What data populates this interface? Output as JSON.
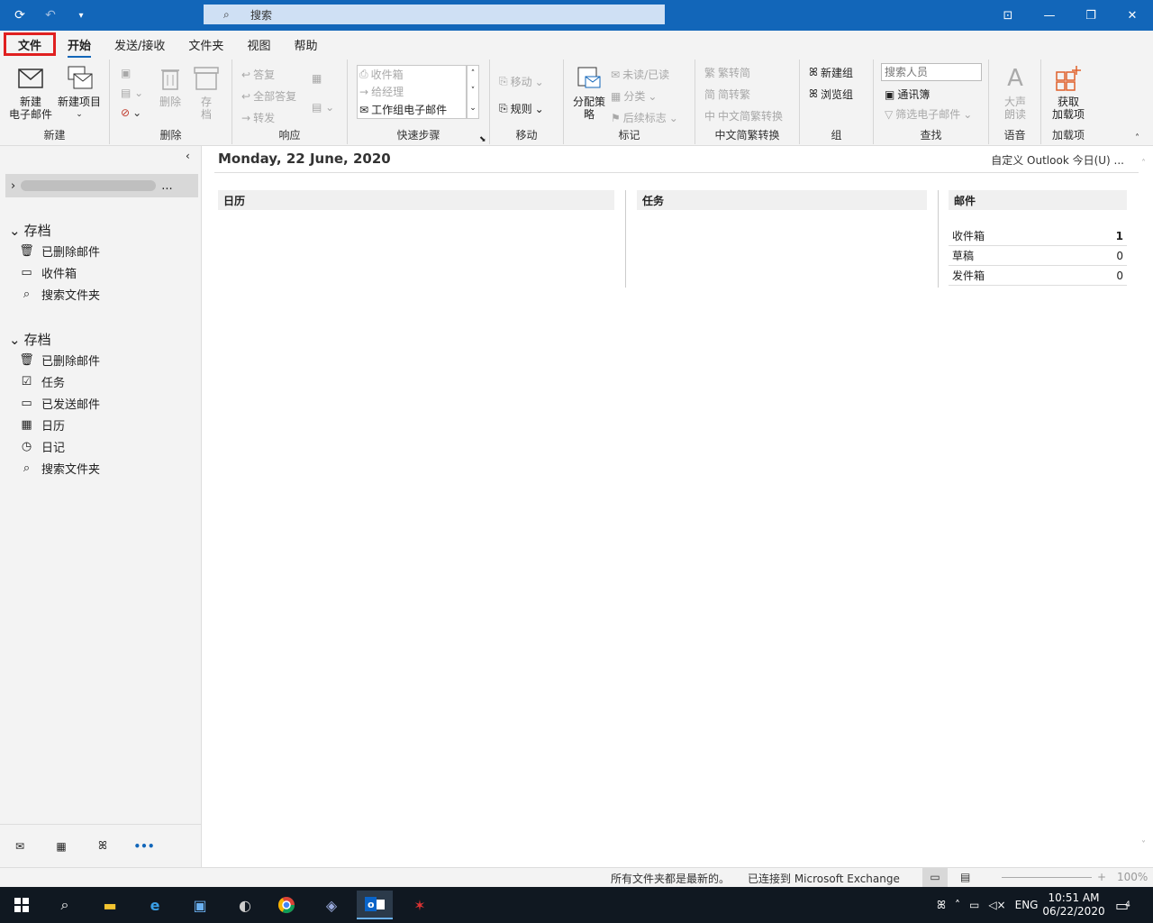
{
  "titlebar": {
    "search_label": "搜索"
  },
  "tabs": {
    "file": "文件",
    "home": "开始",
    "send_receive": "发送/接收",
    "folder": "文件夹",
    "view": "视图",
    "help": "帮助"
  },
  "ribbon": {
    "new": {
      "new_email": "新建\n电子邮件",
      "new_email_l1": "新建",
      "new_email_l2": "电子邮件",
      "new_item": "新建项目",
      "group": "新建"
    },
    "delete": {
      "delete": "删除",
      "archive_l1": "存",
      "archive_l2": "档",
      "group": "删除"
    },
    "respond": {
      "reply": "答复",
      "reply_all": "全部答复",
      "forward": "转发",
      "group": "响应"
    },
    "quicksteps": {
      "items": [
        "收件箱",
        "给经理",
        "工作组电子邮件"
      ],
      "group": "快速步骤"
    },
    "move": {
      "move": "移动",
      "rules": "规则",
      "group": "移动"
    },
    "tags": {
      "assign_policy_l1": "分配策",
      "assign_policy_l2": "略",
      "unread_read": "未读/已读",
      "categorize": "分类",
      "follow_up": "后续标志",
      "group": "标记"
    },
    "chinese": {
      "trad_to_simp": "繁转简",
      "simp_to_trad": "简转繁",
      "convert": "中文简繁转换",
      "group": "中文简繁转换"
    },
    "groups": {
      "new_group": "新建组",
      "browse_groups": "浏览组",
      "group": "组"
    },
    "find": {
      "search_people_placeholder": "搜索人员",
      "address_book": "通讯簿",
      "filter_email": "筛选电子邮件",
      "group": "查找"
    },
    "speech": {
      "read_aloud_l1": "大声",
      "read_aloud_l2": "朗读",
      "group": "语音"
    },
    "addins": {
      "get_addins_l1": "获取",
      "get_addins_l2": "加载项",
      "group": "加载项"
    }
  },
  "nav": {
    "account": "...",
    "sections": [
      {
        "title": "存档",
        "items": [
          "已删除邮件",
          "收件箱",
          "搜索文件夹"
        ]
      },
      {
        "title": "存档",
        "items": [
          "已删除邮件",
          "任务",
          "已发送邮件",
          "日历",
          "日记",
          "搜索文件夹"
        ]
      }
    ]
  },
  "main": {
    "date": "Monday, 22 June, 2020",
    "customize": "自定义 Outlook 今日(U) ...",
    "calendar_title": "日历",
    "tasks_title": "任务",
    "mail_title": "邮件",
    "mail_rows": [
      {
        "name": "收件箱",
        "count": "1"
      },
      {
        "name": "草稿",
        "count": "0"
      },
      {
        "name": "发件箱",
        "count": "0"
      }
    ]
  },
  "status": {
    "left": "所有文件夹都是最新的。",
    "connected": "已连接到 Microsoft Exchange",
    "zoom": "100%"
  },
  "taskbar": {
    "lang": "ENG",
    "time": "10:51 AM",
    "date": "06/22/2020",
    "notifications": "4"
  },
  "colors": {
    "titlebar": "#1266b9",
    "file_tab_border": "#e02020",
    "ribbon_bg": "#f3f3f3",
    "taskbar": "#101821"
  }
}
